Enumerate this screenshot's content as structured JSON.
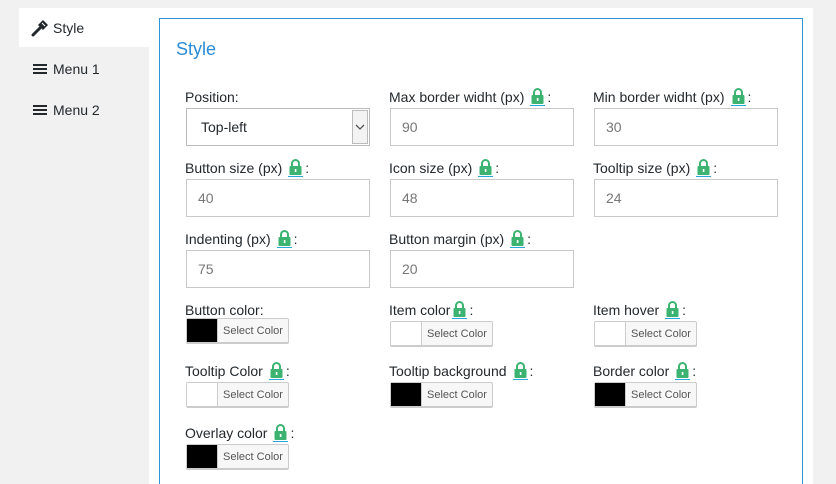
{
  "tabs": [
    {
      "label": "Style",
      "icon": "hammer-icon"
    },
    {
      "label": "Menu 1",
      "icon": "menu-icon"
    },
    {
      "label": "Menu 2",
      "icon": "menu-icon"
    }
  ],
  "panel": {
    "title": "Style"
  },
  "fields": {
    "position": {
      "label": "Position:",
      "value": "Top-left"
    },
    "max_border": {
      "label": "Max border widht (px)",
      "placeholder": "90"
    },
    "min_border": {
      "label": "Min border widht (px)",
      "placeholder": "30"
    },
    "button_size": {
      "label": "Button size (px)",
      "placeholder": "40"
    },
    "icon_size": {
      "label": "Icon size (px)",
      "placeholder": "48"
    },
    "tooltip_size": {
      "label": "Tooltip size (px)",
      "placeholder": "24"
    },
    "indenting": {
      "label": "Indenting (px)",
      "placeholder": "75"
    },
    "button_margin": {
      "label": "Button margin (px)",
      "placeholder": "20"
    }
  },
  "colors": {
    "button_color": {
      "label": "Button color:",
      "swatch": "#000000"
    },
    "item_color": {
      "label": "Item color",
      "swatch": "#ffffff"
    },
    "item_hover": {
      "label": "Item hover",
      "swatch": "#ffffff"
    },
    "tooltip_color": {
      "label": "Tooltip Color",
      "swatch": "#ffffff"
    },
    "tooltip_background": {
      "label": "Tooltip background",
      "swatch": "#000000"
    },
    "border_color": {
      "label": "Border color",
      "swatch": "#000000"
    },
    "overlay_color": {
      "label": "Overlay color",
      "swatch": "#000000"
    }
  },
  "select_color_label": "Select Color",
  "colon": ":",
  "accent": "#2a94d6",
  "lock_color": "#3cb371"
}
